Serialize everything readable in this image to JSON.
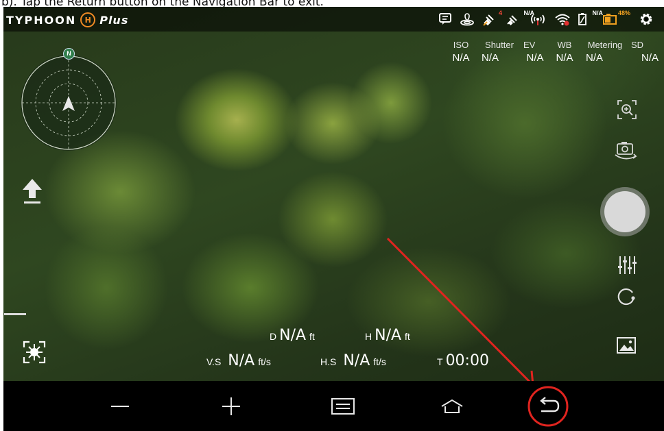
{
  "caption": {
    "text": "b). Tap the Return button on the Navigation Bar to exit."
  },
  "app": {
    "logo_main": "TYPHOON",
    "logo_h": "H",
    "logo_plus": "Plus"
  },
  "status": {
    "satellite_count": "4",
    "gps_value": "N/A",
    "battery_value": "N/A",
    "battery_percent": "48%"
  },
  "camera_params": [
    {
      "label": "ISO",
      "value": "N/A"
    },
    {
      "label": "Shutter",
      "value": "N/A"
    },
    {
      "label": "EV",
      "value": "N/A"
    },
    {
      "label": "WB",
      "value": "N/A"
    },
    {
      "label": "Metering",
      "value": "N/A"
    },
    {
      "label": "SD",
      "value": "N/A"
    }
  ],
  "radar": {
    "north_label": "N"
  },
  "telemetry": {
    "d_label": "D",
    "d_value": "N/A",
    "d_unit": "ft",
    "h_label": "H",
    "h_value": "N/A",
    "h_unit": "ft",
    "vs_label": "V.S",
    "vs_value": "N/A",
    "vs_unit": "ft/s",
    "hs_label": "H.S",
    "hs_value": "N/A",
    "hs_unit": "ft/s",
    "t_label": "T",
    "t_value": "00:00"
  },
  "icons": {
    "left": [
      "takeoff-icon",
      "flight-mode-icon"
    ],
    "right": [
      "zoom-icon",
      "switch-camera-icon",
      "shutter-button",
      "settings-sliders-icon",
      "mode-icon",
      "gallery-icon"
    ],
    "nav": [
      "minus-icon",
      "plus-icon",
      "recent-apps-icon",
      "home-icon",
      "back-icon"
    ]
  },
  "colors": {
    "accent": "#f08a24",
    "annotation": "#e0241f",
    "battery": "#f0a020",
    "wifi_alert": "#e03030"
  }
}
